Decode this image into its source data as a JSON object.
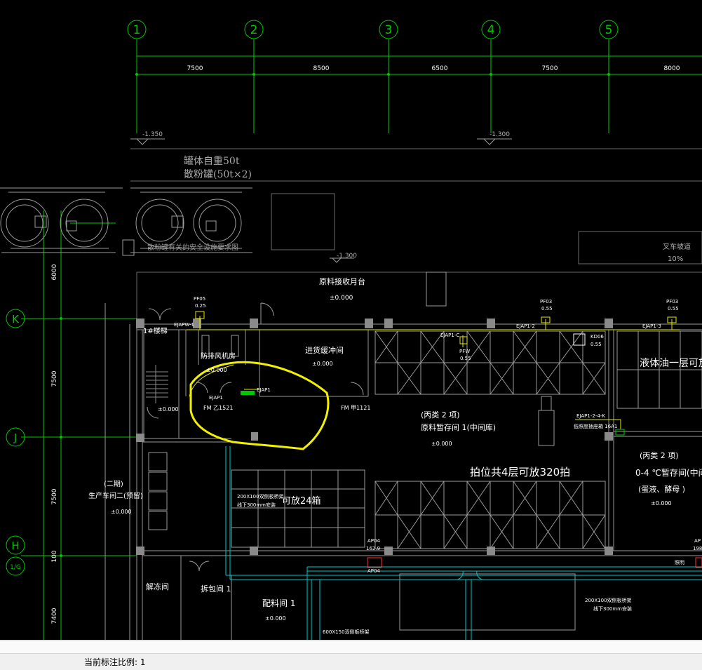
{
  "drawing": {
    "axes": [
      {
        "label": "1"
      },
      {
        "label": "2"
      },
      {
        "label": "3"
      },
      {
        "label": "4"
      },
      {
        "label": "5"
      },
      {
        "label": "K"
      },
      {
        "label": "J"
      },
      {
        "label": "H"
      },
      {
        "label": "1/G"
      }
    ],
    "top_dims": [
      "7500",
      "8500",
      "6500",
      "7500",
      "8000"
    ],
    "left_dims": [
      "6000",
      "7500",
      "7500",
      "100",
      "7400"
    ],
    "levels": {
      "l1": "-1.350",
      "l2": "-1.300",
      "l3": "-1.300"
    },
    "notes": {
      "tank_weight": "罐体自重50t",
      "tank_silo": "散粉罐(50t×2)",
      "tank_caption": "散粉罐有关的安全设施要求图",
      "forklift_ramp": "叉车坡道",
      "ramp_pct": "10%"
    },
    "rooms": {
      "receiving": "原料接收月台",
      "receiving_el": "±0.000",
      "stair": "1#楼梯",
      "stair_el": "±0.000",
      "fanroom": "防排风机房",
      "fanroom_el": "±0.000",
      "buffer": "进货缓冲间",
      "buffer_el": "±0.000",
      "raw_store": "(丙类 2 项)",
      "raw_store2": "原料暂存间 1(中间库)",
      "raw_store_el": "±0.000",
      "pallet": "拍位共4层可放320拍",
      "drum": "液体油一层可放",
      "zone04_a": "(丙类 2 项)",
      "zone04_b": "0-4 ℃暂存间(中间",
      "zone04_c": "(蛋液、酵母 )",
      "zone04_el": "±0.000",
      "prod": "(二期)",
      "prod2": "生产车间二(预留)",
      "prod_el": "±0.000",
      "box": "可放24箱",
      "coldroom": "解冻间",
      "unpack": "拆包间 1",
      "batching": "配料间 1",
      "batching_el": "±0.000"
    },
    "tags": {
      "pf05": "PF05",
      "pf05v": "0.25",
      "pf03": "PF03",
      "pf03v": "0.55",
      "pf03b": "PF03",
      "pf03bv": "0.55",
      "pfw": "PFW",
      "pfwv": "0.55",
      "kd06": "KD06",
      "kd06v": "0.55",
      "ejap1": "EJAP1",
      "ejap2": "EJAP1",
      "ejapw": "EJAPW-1",
      "ejap3": "EJAP1-2",
      "ejap4": "EJAP1-3",
      "ejap5": "EJAP1-2-4-K",
      "ejap6": "EJAP1-C",
      "lighting": "低照度插座箱 16A1",
      "fm1": "FM 乙1521",
      "fm2": "FM 甲1121",
      "ap04": "AP04",
      "ap04v": "162.9",
      "ap04b": "AP04",
      "ap05": "AP",
      "ap05v": "198",
      "duct1": "200X100双侧板桥架",
      "duct1b": "线下300mm安装",
      "duct2": "200X100双侧板桥架",
      "duct2b": "线下300mm安装",
      "duct3": "600X150双侧板桥架",
      "light": "照明"
    }
  },
  "status": {
    "scale_label": "当前标注比例: 1"
  }
}
